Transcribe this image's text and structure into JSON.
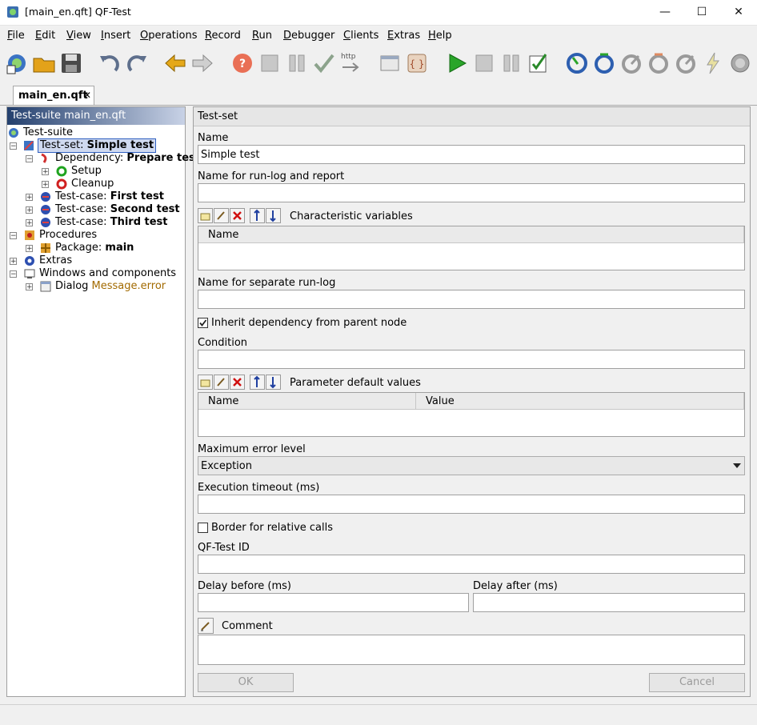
{
  "window": {
    "title": "[main_en.qft] QF-Test",
    "minimize_icon": "—",
    "maximize_icon": "☐",
    "close_icon": "✕"
  },
  "menu": [
    "File",
    "Edit",
    "View",
    "Insert",
    "Operations",
    "Record",
    "Run",
    "Debugger",
    "Clients",
    "Extras",
    "Help"
  ],
  "toolbar": {
    "icons": [
      "new-suite-icon",
      "open-icon",
      "save-icon",
      "undo-icon",
      "redo-icon",
      "back-icon",
      "forward-icon",
      "help-icon",
      "stop-icon",
      "pause-icon",
      "check-icon",
      "http-icon",
      "window-icon",
      "component-icon",
      "play-icon",
      "stop-run-icon",
      "pause-run-icon",
      "checklist-icon",
      "step-in-icon",
      "step-over-icon",
      "step-out-icon",
      "skip-over-icon",
      "skip-out-icon",
      "lightning-icon",
      "continue-icon"
    ],
    "http_text": "http"
  },
  "tab": {
    "label": "main_en.qft",
    "close": "✕"
  },
  "tree": {
    "header": "Test-suite main_en.qft",
    "rows": [
      {
        "type": "Test-suite",
        "name": ""
      },
      {
        "type": "Test-set: ",
        "name": "Simple test"
      },
      {
        "type": "Dependency: ",
        "name": "Prepare test"
      },
      {
        "type": "Setup",
        "name": ""
      },
      {
        "type": "Cleanup",
        "name": ""
      },
      {
        "type": "Test-case: ",
        "name": "First test"
      },
      {
        "type": "Test-case: ",
        "name": "Second test"
      },
      {
        "type": "Test-case: ",
        "name": "Third test"
      },
      {
        "type": "Procedures",
        "name": ""
      },
      {
        "type": "Package: ",
        "name": "main"
      },
      {
        "type": "Extras",
        "name": ""
      },
      {
        "type": "Windows and components",
        "name": ""
      },
      {
        "type": "Dialog ",
        "name": "Message.error"
      }
    ]
  },
  "detail": {
    "header": "Test-set",
    "name_label": "Name",
    "name_value": "Simple test",
    "runlog_label": "Name for run-log and report",
    "runlog_value": "",
    "charvars_label": "Characteristic variables",
    "charvars_col": "Name",
    "separate_label": "Name for separate run-log",
    "separate_value": "",
    "inherit_label": "Inherit dependency from parent node",
    "inherit_checked": true,
    "condition_label": "Condition",
    "condition_value": "",
    "params_label": "Parameter default values",
    "params_cols": [
      "Name",
      "Value"
    ],
    "maxerr_label": "Maximum error level",
    "maxerr_value": "Exception",
    "timeout_label": "Execution timeout (ms)",
    "timeout_value": "",
    "border_label": "Border for relative calls",
    "border_checked": false,
    "qfid_label": "QF-Test ID",
    "qfid_value": "",
    "delay_before_label": "Delay before (ms)",
    "delay_before_value": "",
    "delay_after_label": "Delay after (ms)",
    "delay_after_value": "",
    "comment_label": "Comment",
    "comment_value": "",
    "ok": "OK",
    "cancel": "Cancel"
  }
}
